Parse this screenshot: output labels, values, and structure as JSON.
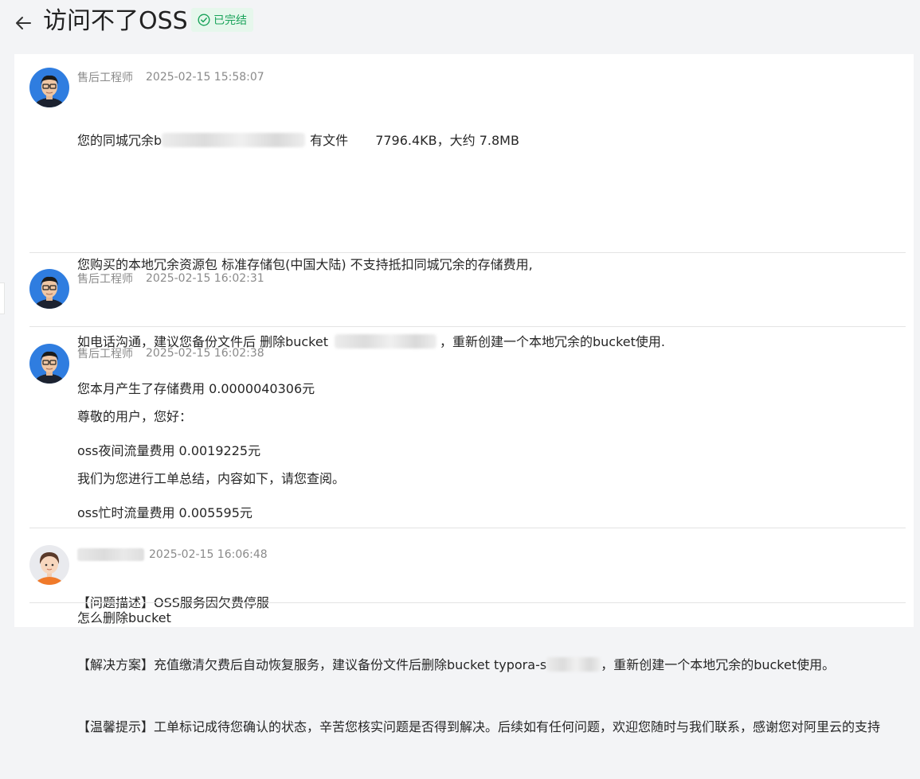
{
  "header": {
    "title": "访问不了OSS",
    "status": "已完结",
    "status_color": "#1aa35a"
  },
  "messages": [
    {
      "author": "售后工程师",
      "time": "2025-02-15 15:58:07",
      "lines": {
        "l1a": "您的同城冗余b",
        "l1b": "有文件",
        "l1c": "7796.4KB，大约 7.8MB",
        "l2": "您购买的本地冗余资源包 标准存储包(中国大陆)  不支持抵扣同城冗余的存储费用,",
        "l3": "您本月产生了存储费用 0.0000040306元",
        "l4": "oss夜间流量费用 0.0019225元",
        "l5": "oss忙时流量费用 0.005595元"
      }
    },
    {
      "author": "售后工程师",
      "time": "2025-02-15 16:02:31",
      "lines": {
        "l1a": "如电话沟通，建议您备份文件后 删除bucket",
        "l1b": "，重新创建一个本地冗余的bucket使用."
      }
    },
    {
      "author": "售后工程师",
      "time": "2025-02-15 16:02:38",
      "lines": {
        "l1": "尊敬的用户，您好：",
        "l2": "我们为您进行工单总结，内容如下，请您查阅。",
        "l3": "【问题描述】OSS服务因欠费停服",
        "l4a": "【解决方案】充值缴清欠费后自动恢复服务，建议备份文件后删除bucket typora-s",
        "l4b": "，重新创建一个本地冗余的bucket使用。",
        "l5": "【温馨提示】工单标记成待您确认的状态，辛苦您核实问题是否得到解决。后续如有任何问题，欢迎您随时与我们联系，感谢您对阿里云的支持"
      }
    },
    {
      "author": "",
      "time": "2025-02-15 16:06:48",
      "lines": {
        "l1": "怎么删除bucket"
      }
    }
  ]
}
